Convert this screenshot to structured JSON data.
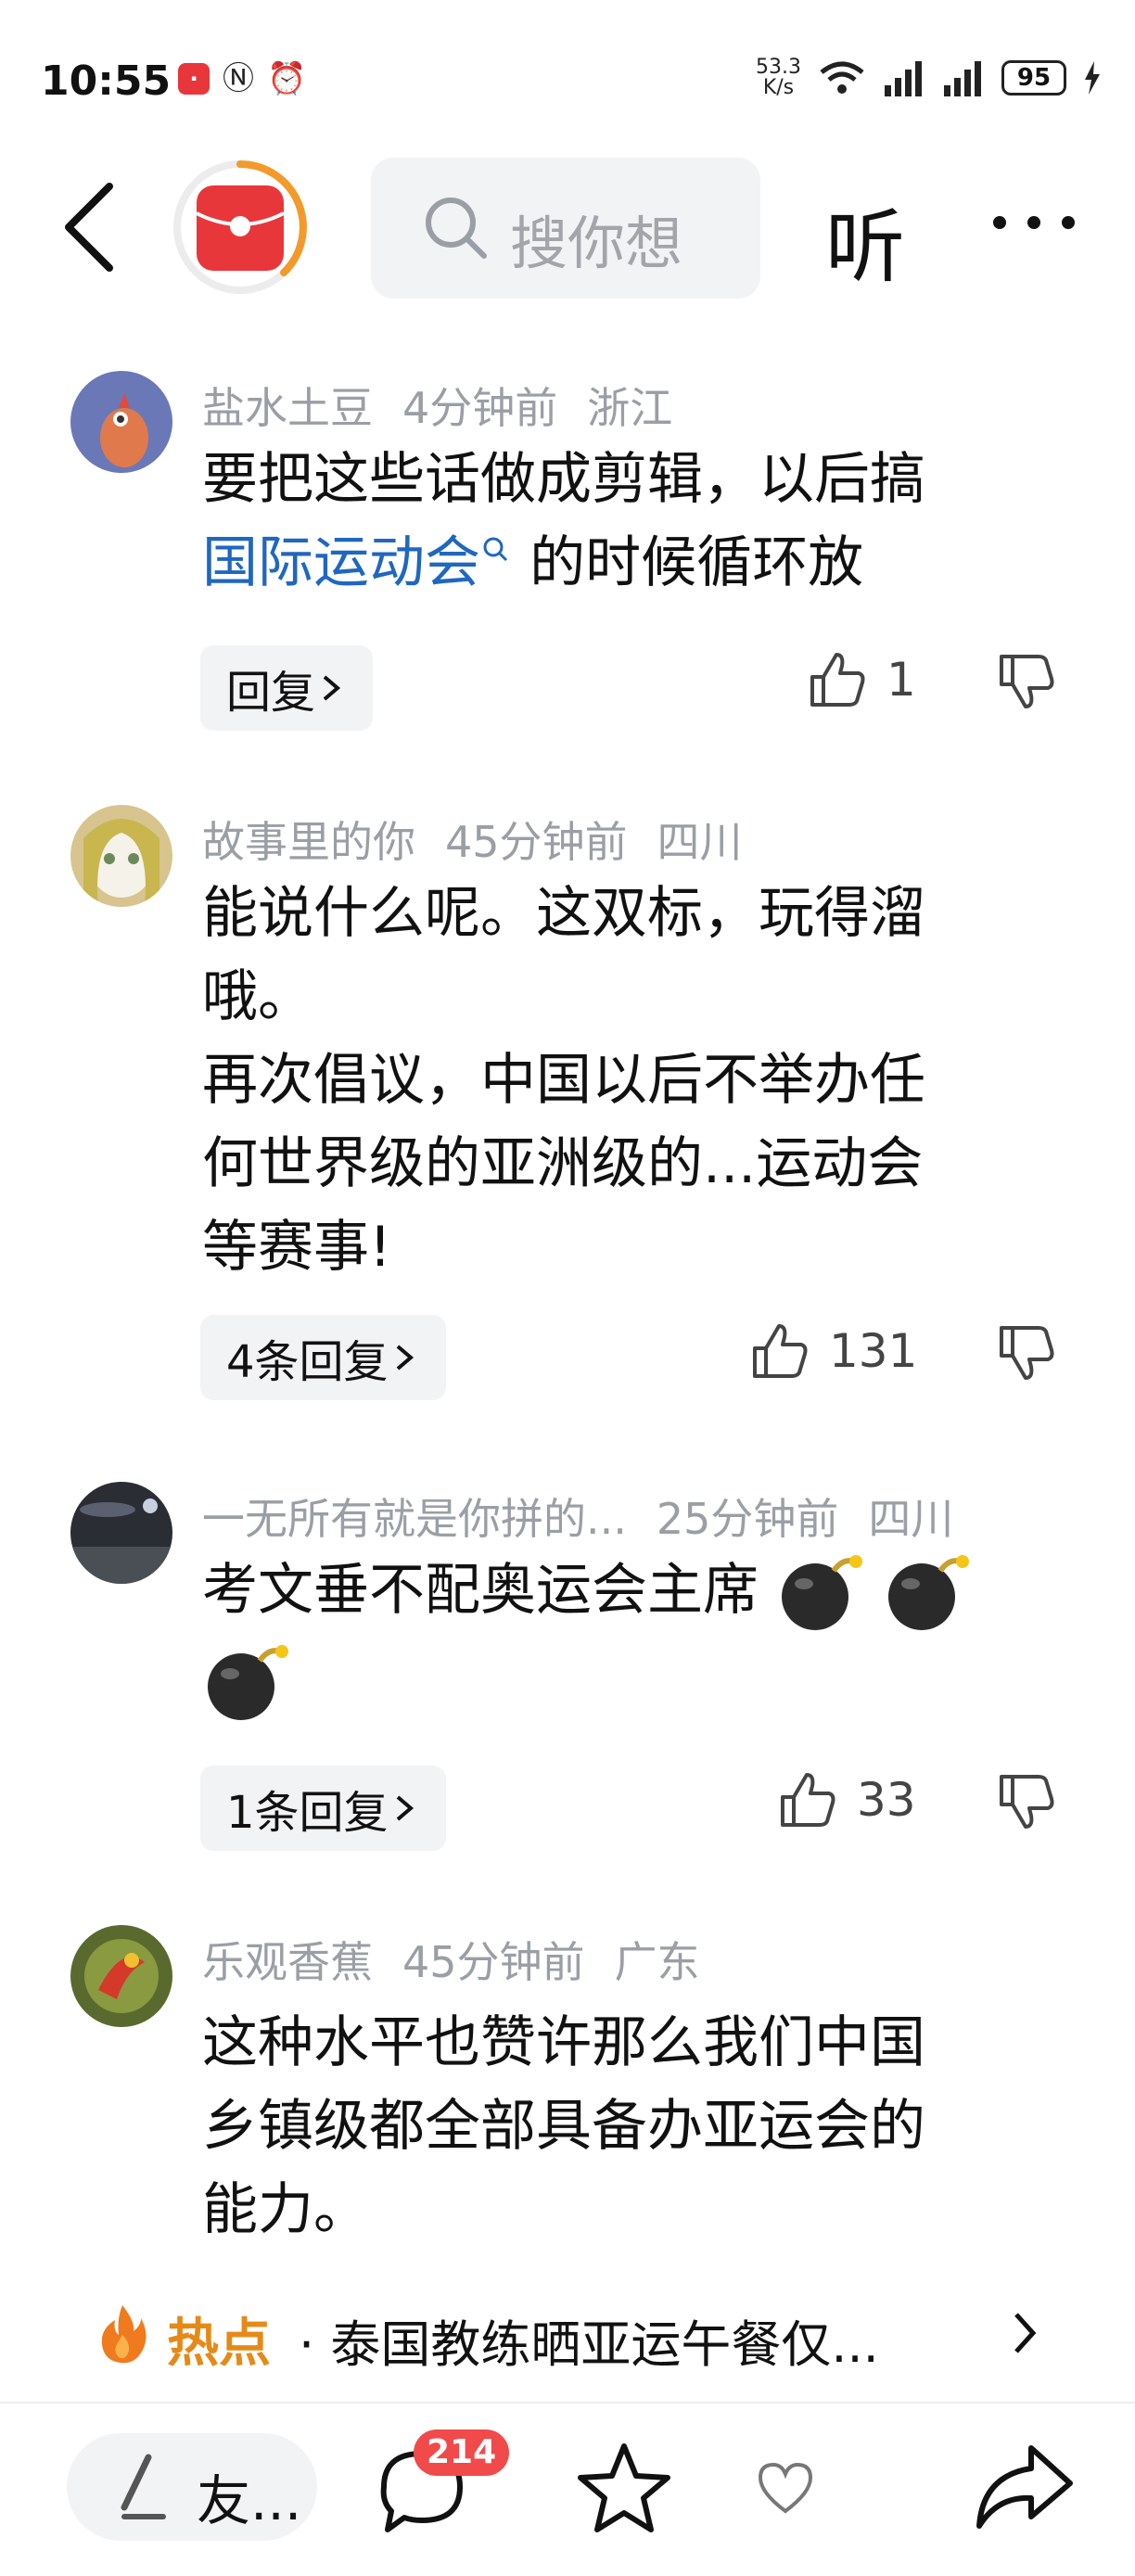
{
  "status_bar": {
    "time": "10:55",
    "net_speed_value": "53.3",
    "net_speed_unit": "K/s",
    "battery": "95"
  },
  "top_nav": {
    "search_placeholder": "搜你想",
    "listen_label": "听"
  },
  "comments": [
    {
      "user": "盐水土豆",
      "time": "4分钟前",
      "location": "浙江",
      "text_line1": "要把这些话做成剪辑，以后搞",
      "link": "国际运动会",
      "text_after_link": " 的时候循环放",
      "reply_label": "回复",
      "likes": "1"
    },
    {
      "user": "故事里的你",
      "time": "45分钟前",
      "location": "四川",
      "text_lines": [
        "能说什么呢。这双标，玩得溜",
        "哦。",
        "再次倡议，中国以后不举办任",
        "何世界级的亚洲级的...运动会",
        "等赛事!"
      ],
      "reply_label": "4条回复",
      "likes": "131"
    },
    {
      "user": "一无所有就是你拼的...",
      "time": "25分钟前",
      "location": "四川",
      "text": "考文垂不配奥运会主席",
      "reply_label": "1条回复",
      "likes": "33"
    },
    {
      "user": "乐观香蕉",
      "time": "45分钟前",
      "location": "广东",
      "text_lines": [
        "这种水平也赞许那么我们中国",
        "乡镇级都全部具备办亚运会的",
        "能力。"
      ]
    }
  ],
  "hot": {
    "label": "热点",
    "text": "· 泰国教练晒亚运午餐仅..."
  },
  "bottom_bar": {
    "write_label": "友...",
    "comment_count": "214"
  },
  "colors": {
    "link": "#1f67c0",
    "hot": "#e58a18",
    "badge": "#f04a4a",
    "accent_ring": "#f39a2b"
  },
  "icons": [
    "back-icon",
    "app-logo-icon",
    "search-icon",
    "more-icon",
    "like-icon",
    "dislike-icon",
    "chevron-right-icon",
    "fire-icon",
    "pen-icon",
    "comment-icon",
    "star-icon",
    "heart-icon",
    "share-icon"
  ]
}
